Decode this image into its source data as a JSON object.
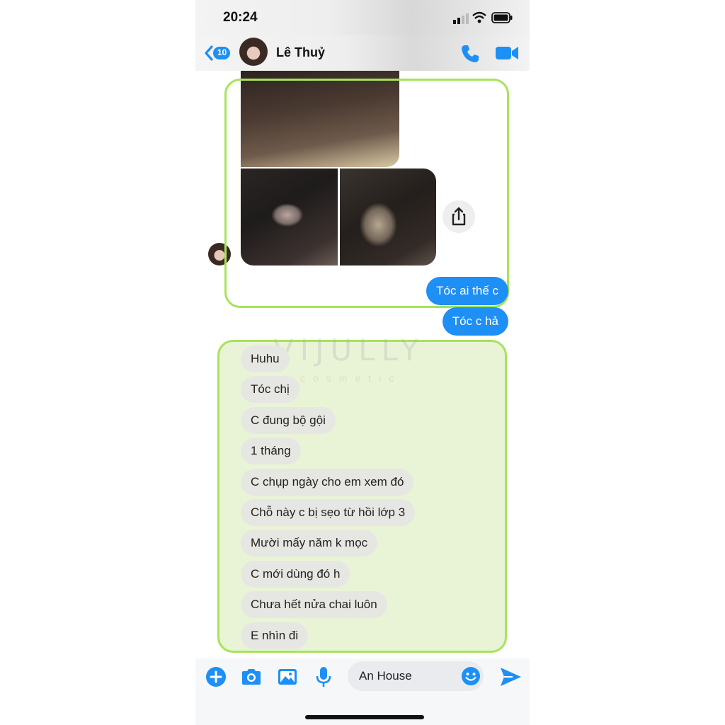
{
  "status_bar": {
    "time": "20:24"
  },
  "header": {
    "back_badge": "10",
    "contact_name": "Lê Thuỷ"
  },
  "outgoing_messages": [
    "Tóc ai thế c",
    "Tóc c hả"
  ],
  "incoming_messages": [
    "Huhu",
    "Tóc chị",
    "C đung bộ gội",
    "1 tháng",
    "C chụp ngày cho em xem đó",
    "Chỗ này c bị sẹo từ hồi lớp 3",
    "Mười mấy năm k mọc",
    "C mới dùng đó h",
    "Chưa hết nửa chai luôn",
    "E nhìn đi"
  ],
  "watermark": {
    "brand": "VIJULLY",
    "sub": "cosmetic"
  },
  "composer": {
    "text": "An House"
  },
  "colors": {
    "accent": "#1d8ff5",
    "highlight": "#a8e35a",
    "incoming_bubble": "#e6e7e2"
  }
}
